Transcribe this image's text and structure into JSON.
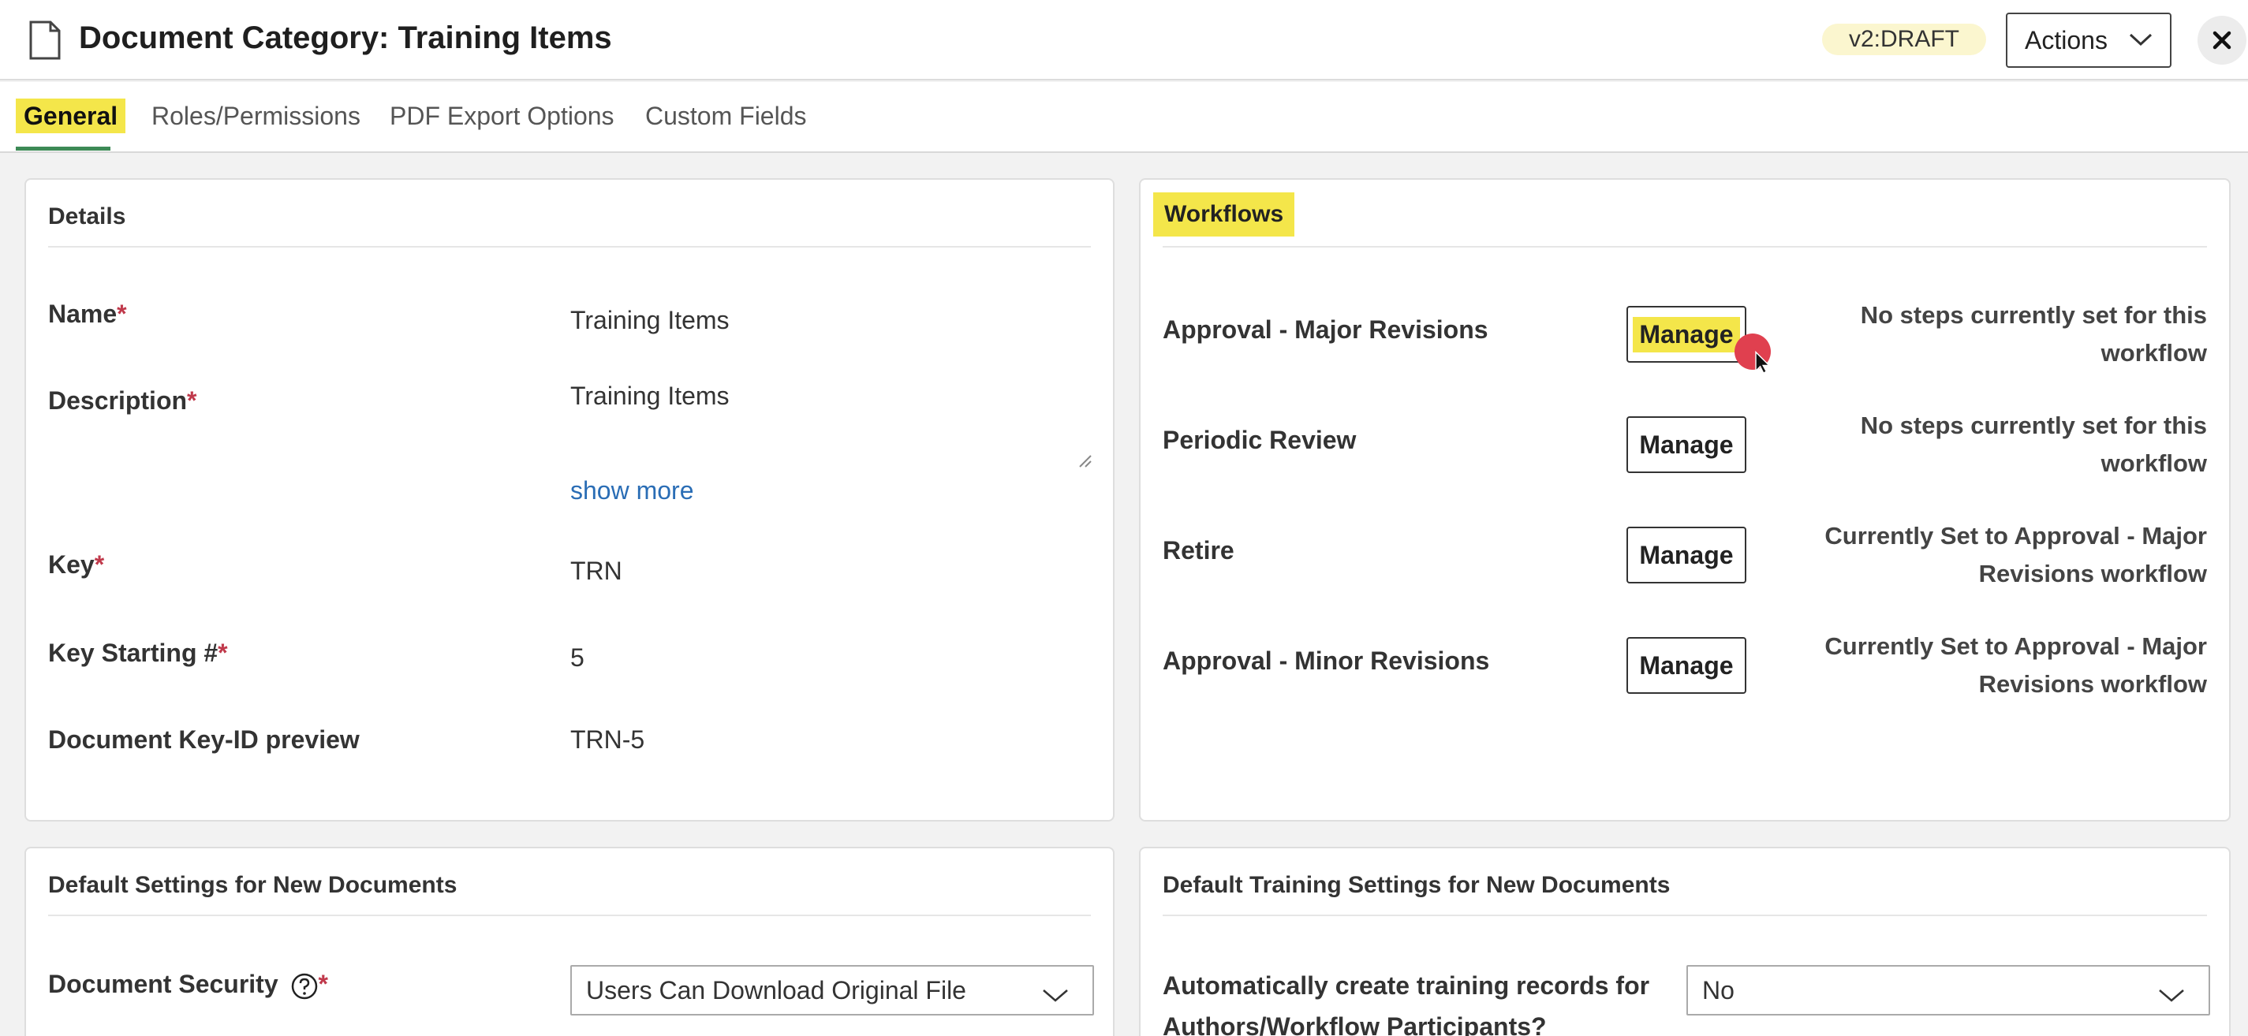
{
  "header": {
    "title": "Document Category: Training Items",
    "version_badge": "v2:DRAFT",
    "actions_label": "Actions",
    "close_symbol": "✕"
  },
  "tabs": [
    {
      "label": "General",
      "active": true
    },
    {
      "label": "Roles/Permissions",
      "active": false
    },
    {
      "label": "PDF Export Options",
      "active": false
    },
    {
      "label": "Custom Fields",
      "active": false
    }
  ],
  "details": {
    "title": "Details",
    "name_label": "Name",
    "name_value": "Training Items",
    "description_label": "Description",
    "description_value": "Training Items",
    "show_more": "show more",
    "key_label": "Key",
    "key_value": "TRN",
    "key_start_label": "Key Starting #",
    "key_start_value": "5",
    "preview_label": "Document Key-ID preview",
    "preview_value": "TRN-5",
    "required_mark": "*"
  },
  "workflows": {
    "title": "Workflows",
    "manage_label": "Manage",
    "items": [
      {
        "name": "Approval - Major Revisions",
        "status": "No steps currently set for this workflow"
      },
      {
        "name": "Periodic Review",
        "status": "No steps currently set for this workflow"
      },
      {
        "name": "Retire",
        "status": "Currently Set to Approval - Major Revisions workflow"
      },
      {
        "name": "Approval - Minor Revisions",
        "status": "Currently Set to Approval - Major Revisions workflow"
      }
    ]
  },
  "defaults": {
    "title": "Default Settings for New Documents",
    "security_label": "Document Security",
    "security_value": "Users Can Download Original File"
  },
  "training": {
    "title": "Default Training Settings for New Documents",
    "auto_label": "Automatically create training records for Authors/Workflow Participants?",
    "auto_value": "No"
  },
  "colors": {
    "highlight": "#f4e64a",
    "tab_underline": "#3d8a56",
    "link": "#2a6db5",
    "required": "#c0394b",
    "cursor_dot": "#e0404f"
  },
  "icons": [
    "document-icon",
    "chevron-down-icon",
    "close-icon",
    "help-circle-icon",
    "mouse-pointer-icon"
  ]
}
